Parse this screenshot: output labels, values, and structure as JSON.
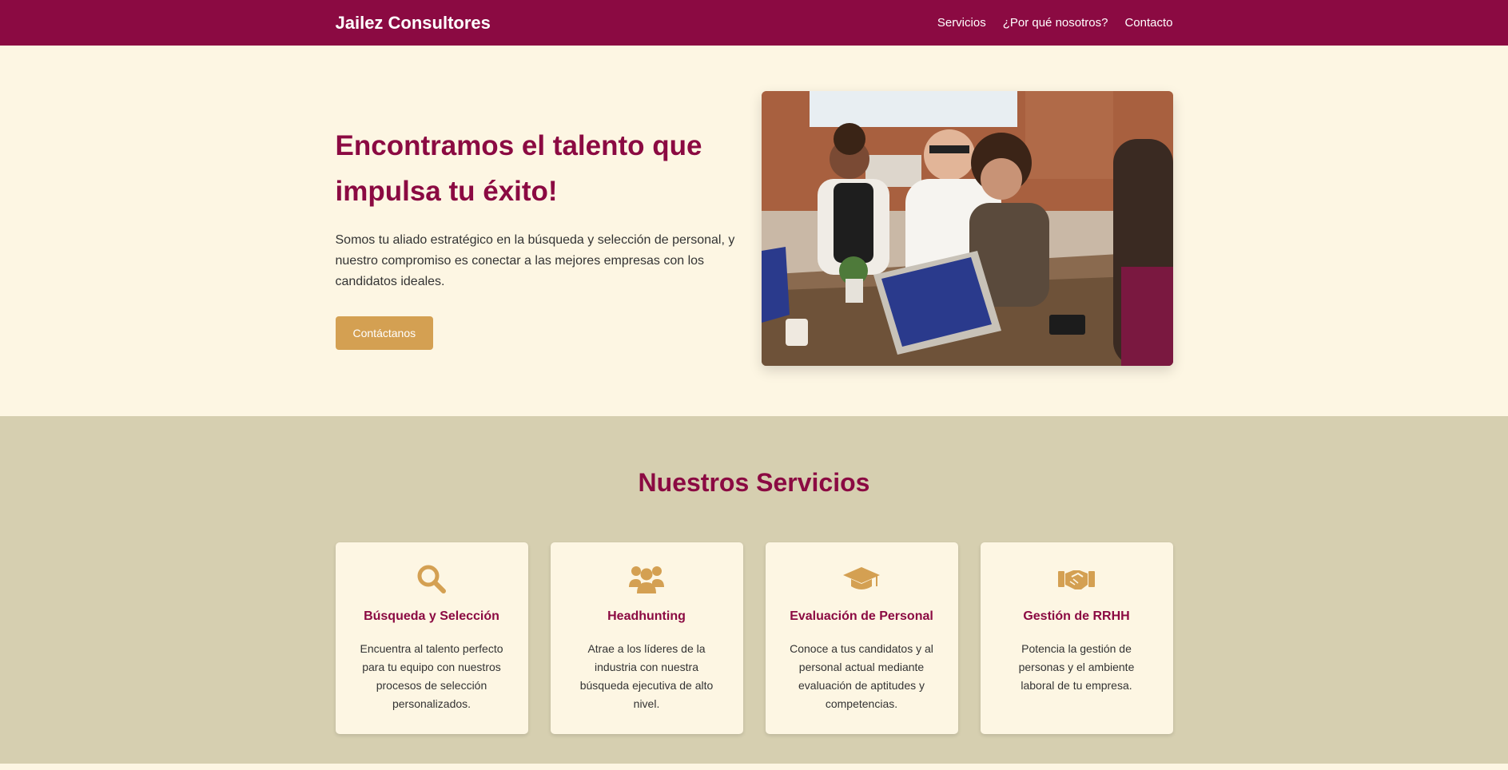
{
  "nav": {
    "brand": "Jailez Consultores",
    "links": [
      "Servicios",
      "¿Por qué nosotros?",
      "Contacto"
    ]
  },
  "hero": {
    "title": "Encontramos el talento que impulsa tu éxito!",
    "subtitle": "Somos tu aliado estratégico en la búsqueda y selección de personal, y nuestro compromiso es conectar a las mejores empresas con los candidatos ideales.",
    "cta": "Contáctanos"
  },
  "services": {
    "title": "Nuestros Servicios",
    "cards": [
      {
        "icon": "search-icon",
        "title": "Búsqueda y Selección",
        "text": "Encuentra al talento perfecto para tu equipo con nuestros procesos de selección personalizados."
      },
      {
        "icon": "users-icon",
        "title": "Headhunting",
        "text": "Atrae a los líderes de la industria con nuestra búsqueda ejecutiva de alto nivel."
      },
      {
        "icon": "graduation-cap-icon",
        "title": "Evaluación de Personal",
        "text": "Conoce a tus candidatos y al personal actual mediante evaluación de aptitudes y competencias."
      },
      {
        "icon": "handshake-icon",
        "title": "Gestión de RRHH",
        "text": "Potencia la gestión de personas y el ambiente laboral de tu empresa."
      }
    ]
  },
  "colors": {
    "primary": "#8b0a42",
    "accent": "#d4a052",
    "cream": "#fdf6e3",
    "beige": "#d6cfb0"
  }
}
